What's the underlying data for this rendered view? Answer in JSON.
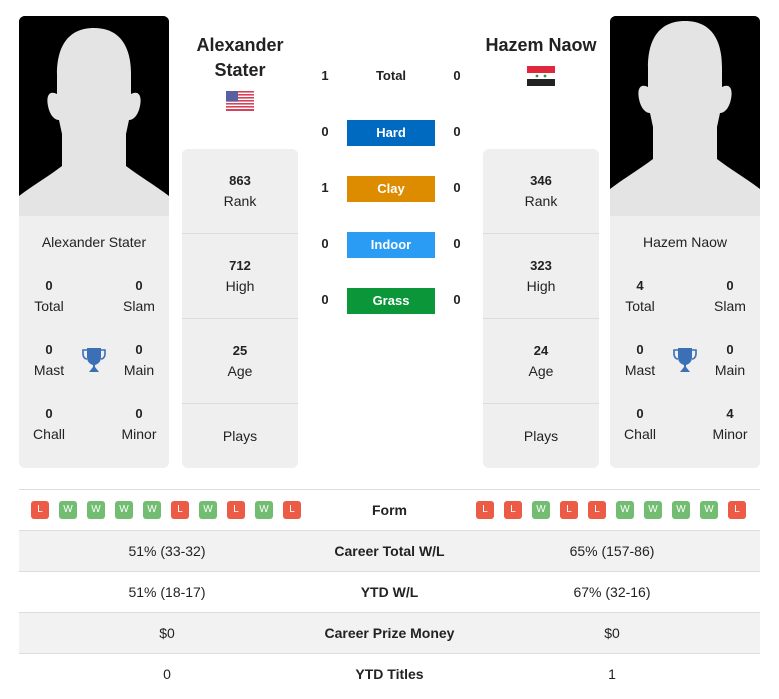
{
  "player1": {
    "name": "Alexander Stater",
    "header_name_line1": "Alexander",
    "header_name_line2": "Stater",
    "flag": "us-flag",
    "titles": {
      "total": {
        "value": "0",
        "label": "Total"
      },
      "slam": {
        "value": "0",
        "label": "Slam"
      },
      "mast": {
        "value": "0",
        "label": "Mast"
      },
      "main": {
        "value": "0",
        "label": "Main"
      },
      "chall": {
        "value": "0",
        "label": "Chall"
      },
      "minor": {
        "value": "0",
        "label": "Minor"
      }
    },
    "rank": {
      "value": "863",
      "label": "Rank"
    },
    "high": {
      "value": "712",
      "label": "High"
    },
    "age": {
      "value": "25",
      "label": "Age"
    },
    "plays": {
      "label": "Plays"
    }
  },
  "player2": {
    "name": "Hazem Naow",
    "header_name": "Hazem Naow",
    "flag": "syria-flag",
    "titles": {
      "total": {
        "value": "4",
        "label": "Total"
      },
      "slam": {
        "value": "0",
        "label": "Slam"
      },
      "mast": {
        "value": "0",
        "label": "Mast"
      },
      "main": {
        "value": "0",
        "label": "Main"
      },
      "chall": {
        "value": "0",
        "label": "Chall"
      },
      "minor": {
        "value": "4",
        "label": "Minor"
      }
    },
    "rank": {
      "value": "346",
      "label": "Rank"
    },
    "high": {
      "value": "323",
      "label": "High"
    },
    "age": {
      "value": "24",
      "label": "Age"
    },
    "plays": {
      "label": "Plays"
    }
  },
  "h2h": {
    "total": {
      "label": "Total",
      "p1": "1",
      "p2": "0"
    },
    "surfaces": [
      {
        "label": "Hard",
        "p1": "0",
        "p2": "0",
        "color": "#0069c0"
      },
      {
        "label": "Clay",
        "p1": "1",
        "p2": "0",
        "color": "#dd8c00"
      },
      {
        "label": "Indoor",
        "p1": "0",
        "p2": "0",
        "color": "#2b9cf3"
      },
      {
        "label": "Grass",
        "p1": "0",
        "p2": "0",
        "color": "#0a9639"
      }
    ]
  },
  "form": {
    "label": "Form",
    "p1": [
      "L",
      "W",
      "W",
      "W",
      "W",
      "L",
      "W",
      "L",
      "W",
      "L"
    ],
    "p2": [
      "L",
      "L",
      "W",
      "L",
      "L",
      "W",
      "W",
      "W",
      "W",
      "L"
    ]
  },
  "stats": [
    {
      "label": "Career Total W/L",
      "p1": "51% (33-32)",
      "p2": "65% (157-86)"
    },
    {
      "label": "YTD W/L",
      "p1": "51% (18-17)",
      "p2": "67% (32-16)"
    },
    {
      "label": "Career Prize Money",
      "p1": "$0",
      "p2": "$0"
    },
    {
      "label": "YTD Titles",
      "p1": "0",
      "p2": "1"
    }
  ],
  "colors": {
    "win": "#73bd73",
    "loss": "#eb5b45",
    "trophy": "#3b6fb6",
    "card_bg": "#efefef"
  }
}
